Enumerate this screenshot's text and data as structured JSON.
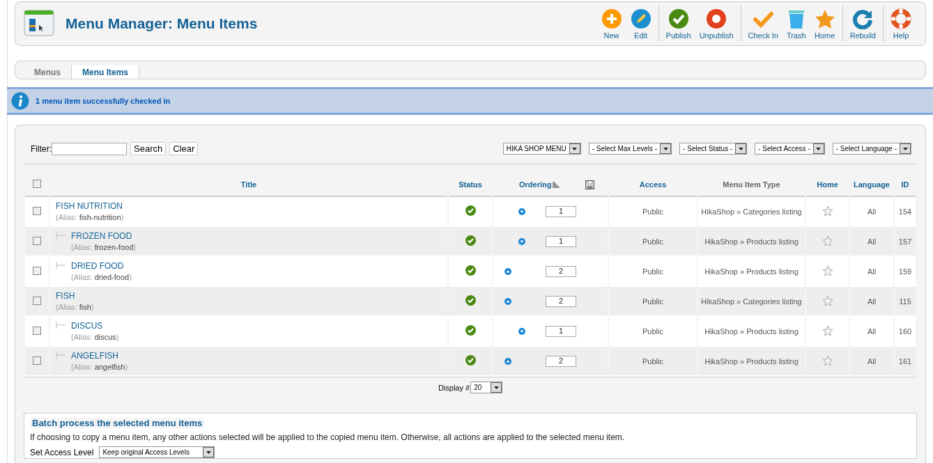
{
  "header": {
    "title": "Menu Manager: Menu Items"
  },
  "toolbar": [
    [
      {
        "label": "New",
        "kind": "new"
      },
      {
        "label": "Edit",
        "kind": "edit"
      }
    ],
    [
      {
        "label": "Publish",
        "kind": "publish"
      },
      {
        "label": "Unpublish",
        "kind": "unpublish"
      }
    ],
    [
      {
        "label": "Check In",
        "kind": "checkin"
      },
      {
        "label": "Trash",
        "kind": "trash"
      },
      {
        "label": "Home",
        "kind": "home"
      }
    ],
    [
      {
        "label": "Rebuild",
        "kind": "rebuild"
      }
    ],
    [
      {
        "label": "Help",
        "kind": "help"
      }
    ]
  ],
  "tabs": [
    {
      "label": "Menus",
      "selected": false
    },
    {
      "label": "Menu Items",
      "selected": true
    }
  ],
  "message": "1 menu item successfully checked in",
  "filter": {
    "label": "Filter:",
    "buttons": [
      "Search",
      "Clear"
    ]
  },
  "selects": [
    "HIKA SHOP MENU",
    "- Select Max Levels -",
    "- Select Status -",
    "- Select Access -",
    "- Select Language -"
  ],
  "table": {
    "select_all_checked": false,
    "columns": [
      {
        "label": "Title",
        "sortable": true
      },
      {
        "label": "Status",
        "sortable": true
      },
      {
        "label": "Ordering",
        "sortable": true
      },
      {
        "label": "Access",
        "sortable": true
      },
      {
        "label": "Menu Item Type",
        "sortable": false
      },
      {
        "label": "Home",
        "sortable": true
      },
      {
        "label": "Language",
        "sortable": true
      },
      {
        "label": "ID",
        "sortable": true
      }
    ],
    "rows": [
      {
        "title": "FISH NUTRITION",
        "alias_label": "(Alias:",
        "alias": "fish-nutrition",
        "alias_close": ")",
        "checked": false,
        "published": true,
        "order_up": false,
        "order_down": true,
        "order": "1",
        "access": "Public",
        "type": "HikaShop » Categories listing",
        "home": false,
        "language": "All",
        "id": "154",
        "children": [
          {
            "title": "FROZEN FOOD",
            "alias_label": "(Alias:",
            "alias": "frozen-food",
            "alias_close": ")",
            "checked": false,
            "published": true,
            "order_up": false,
            "order_down": true,
            "order": "1",
            "access": "Public",
            "type": "HikaShop » Products listing",
            "home": false,
            "language": "All",
            "id": "157"
          },
          {
            "title": "DRIED FOOD",
            "alias_label": "(Alias:",
            "alias": "dried-food",
            "alias_close": ")",
            "checked": false,
            "published": true,
            "order_up": true,
            "order_down": false,
            "order": "2",
            "access": "Public",
            "type": "HikaShop » Products listing",
            "home": false,
            "language": "All",
            "id": "159"
          }
        ]
      },
      {
        "title": "FISH",
        "alias_label": "(Alias:",
        "alias": "fish",
        "alias_close": ")",
        "checked": false,
        "published": true,
        "order_up": true,
        "order_down": false,
        "order": "2",
        "access": "Public",
        "type": "HikaShop » Categories listing",
        "home": false,
        "language": "All",
        "id": "115",
        "children": [
          {
            "title": "DISCUS",
            "alias_label": "(Alias:",
            "alias": "discus",
            "alias_close": ")",
            "checked": false,
            "published": true,
            "order_up": false,
            "order_down": true,
            "order": "1",
            "access": "Public",
            "type": "HikaShop » Products listing",
            "home": false,
            "language": "All",
            "id": "160"
          },
          {
            "title": "ANGELFISH",
            "alias_label": "(Alias:",
            "alias": "angelfish",
            "alias_close": ")",
            "checked": false,
            "published": true,
            "order_up": true,
            "order_down": false,
            "order": "2",
            "access": "Public",
            "type": "HikaShop » Products listing",
            "home": false,
            "language": "All",
            "id": "161"
          }
        ]
      }
    ]
  },
  "pagination": {
    "label": "Display #",
    "value": "20"
  },
  "batch": {
    "legend": "Batch process the selected menu items",
    "text": "If choosing to copy a menu item, any other actions selected will be applied to the copied menu item. Otherwise, all actions are applied to the selected menu item.",
    "access_label": "Set Access Level",
    "access_value": "Keep original Access Levels"
  }
}
